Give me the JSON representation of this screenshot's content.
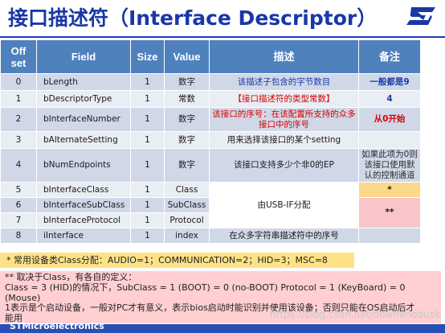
{
  "header": {
    "title": "接口描述符（Interface Descriptor）",
    "logo_text": "ST",
    "colors": {
      "title": "#1a37a8",
      "logo": "#1a37a8",
      "rule": "#1f3fb0"
    }
  },
  "table": {
    "columns": [
      "Offset",
      "Field",
      "Size",
      "Value",
      "描述",
      "备注"
    ],
    "rows": [
      {
        "offset": "0",
        "field": "bLength",
        "size": "1",
        "value": "数字",
        "desc": "该描述子包含的字节数目",
        "note": "一般都是9"
      },
      {
        "offset": "1",
        "field": "bDescriptorType",
        "size": "1",
        "value": "常数",
        "desc": "【接口描述符的类型常数】",
        "note": "4"
      },
      {
        "offset": "2",
        "field": "bInterfaceNumber",
        "size": "1",
        "value": "数字",
        "desc": "该接口的序号：在该配置所支持的众多接口中的序号",
        "note": "从0开始"
      },
      {
        "offset": "3",
        "field": "bAlternateSetting",
        "size": "1",
        "value": "数字",
        "desc": "用来选择该接口的某个setting",
        "note": ""
      },
      {
        "offset": "4",
        "field": "bNumEndpoints",
        "size": "1",
        "value": "数字",
        "desc": "该接口支持多少个非0的EP",
        "note": "如果此项为0则该接口使用默认的控制通道"
      },
      {
        "offset": "5",
        "field": "bInterfaceClass",
        "size": "1",
        "value": "Class",
        "desc": "由USB-IF分配",
        "note": "*"
      },
      {
        "offset": "6",
        "field": "bInterfaceSubClass",
        "size": "1",
        "value": "SubClass",
        "desc": "",
        "note": "**"
      },
      {
        "offset": "7",
        "field": "bInterfaceProtocol",
        "size": "1",
        "value": "Protocol",
        "desc": "",
        "note": ""
      },
      {
        "offset": "8",
        "field": "iInterface",
        "size": "1",
        "value": "index",
        "desc": "在众多字符串描述符中的序号",
        "note": ""
      }
    ]
  },
  "notes": {
    "class_note": "* 常用设备类Class分配：AUDIO=1；COMMUNICATION=2；HID=3；MSC=8",
    "subclass_lines": [
      "** 取决于Class，有各自的定义：",
      "Class = 3 (HID)的情况下，SubClass = 1 (BOOT) = 0 (no-BOOT) Protocol = 1 (KeyBoard) = 0",
      "(Mouse)",
      "1表示是个启动设备，一般对PC才有意义，表示bios启动时能识别并使用该设备；否则只能在OS启动后才",
      "能用"
    ]
  },
  "footer": {
    "text": "STMicroelectronics",
    "watermark": "https://blog.csdn.net/downanddusk"
  }
}
